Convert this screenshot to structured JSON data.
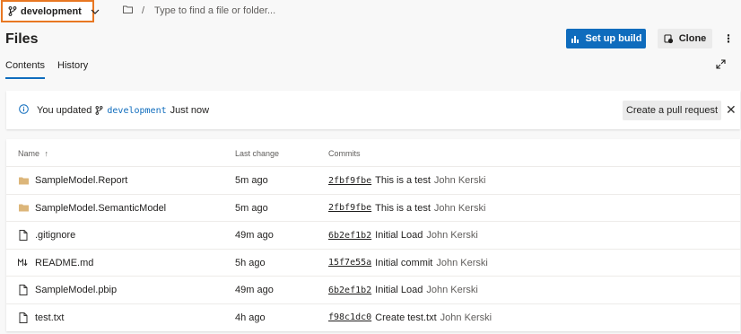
{
  "topbar": {
    "branch": "development",
    "path_placeholder": "Type to find a file or folder...",
    "path_separator": "/"
  },
  "header": {
    "title": "Files",
    "setup_build": "Set up build",
    "clone": "Clone"
  },
  "tabs": [
    {
      "label": "Contents",
      "active": true
    },
    {
      "label": "History",
      "active": false
    }
  ],
  "notice": {
    "prefix": "You updated",
    "branch": "development",
    "suffix": "Just now",
    "pull_request": "Create a pull request"
  },
  "table": {
    "columns": [
      "Name",
      "Last change",
      "Commits"
    ],
    "sort_indicator": "↑",
    "rows": [
      {
        "icon": "folder-icon",
        "name": "SampleModel.Report",
        "last_change": "5m ago",
        "hash": "2fbf9fbe",
        "message": "This is a test",
        "author": "John Kerski"
      },
      {
        "icon": "folder-icon",
        "name": "SampleModel.SemanticModel",
        "last_change": "5m ago",
        "hash": "2fbf9fbe",
        "message": "This is a test",
        "author": "John Kerski"
      },
      {
        "icon": "file-icon",
        "name": ".gitignore",
        "last_change": "49m ago",
        "hash": "6b2ef1b2",
        "message": "Initial Load",
        "author": "John Kerski"
      },
      {
        "icon": "markdown-icon",
        "name": "README.md",
        "last_change": "5h ago",
        "hash": "15f7e55a",
        "message": "Initial commit",
        "author": "John Kerski"
      },
      {
        "icon": "file-icon",
        "name": "SampleModel.pbip",
        "last_change": "49m ago",
        "hash": "6b2ef1b2",
        "message": "Initial Load",
        "author": "John Kerski"
      },
      {
        "icon": "file-icon",
        "name": "test.txt",
        "last_change": "4h ago",
        "hash": "f98c1dc0",
        "message": "Create test.txt",
        "author": "John Kerski"
      }
    ]
  },
  "colors": {
    "accent": "#0f6cbd",
    "highlight_border": "#e87722",
    "folder": "#dcb67a"
  }
}
